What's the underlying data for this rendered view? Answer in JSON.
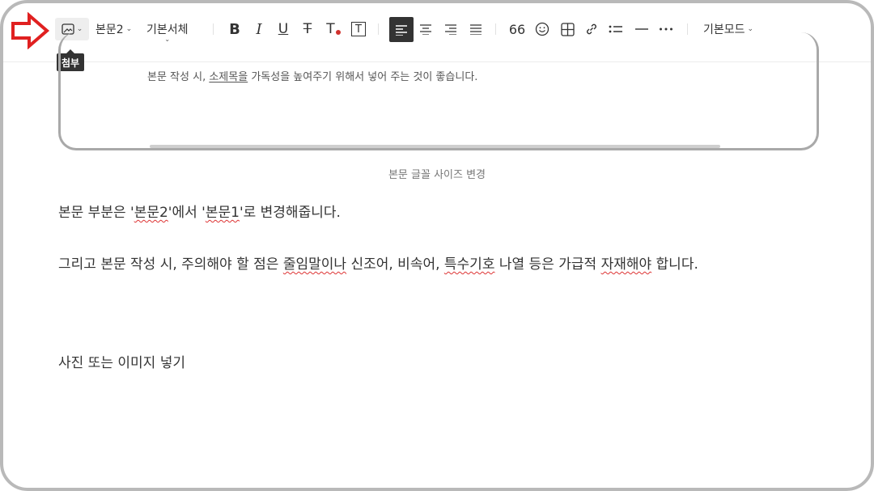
{
  "toolbar": {
    "attach_tooltip": "첨부",
    "paragraph_style": "본문2",
    "font_family": "기본서체",
    "quote_label": "66",
    "mode": "기본모드",
    "colors": {
      "accent_arrow": "#e02020",
      "text_color_dot": "#d0312d"
    }
  },
  "card": {
    "text_prefix": "본문 작성 시, ",
    "text_underlined": "소제목을",
    "text_suffix": " 가독성을 높여주기 위해서 넣어 주는 것이 좋습니다."
  },
  "caption": "본문 글꼴 사이즈 변경",
  "para1": {
    "t1": "본문 부분은 '",
    "t2": "본문2",
    "t3": "'에서 '",
    "t4": "본문1",
    "t5": "'로 변경해줍니다."
  },
  "para2": {
    "t1": "그리고 본문 작성 시, 주의해야 할 점은 ",
    "t2": "줄임말이나",
    "t3": " 신조어, 비속어, ",
    "t4": "특수기호",
    "t5": " 나열 등은 가급적 ",
    "t6": "자재해야",
    "t7": " 합니다."
  },
  "para3": "사진 또는 이미지 넣기"
}
